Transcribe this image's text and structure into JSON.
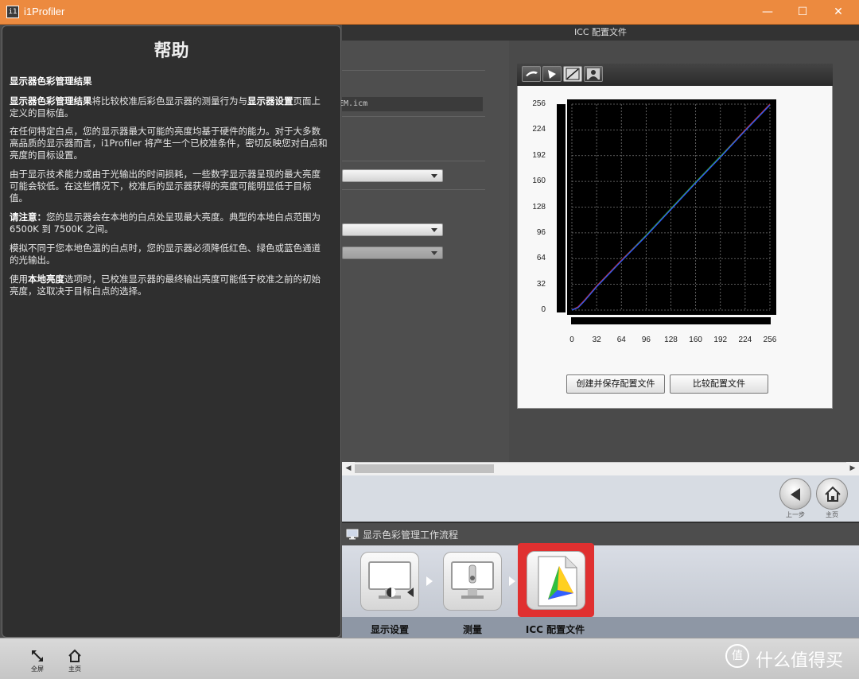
{
  "window": {
    "title": "i1Profiler",
    "app_icon": "i1",
    "minimize": "—",
    "maximize": "☐",
    "close": "✕"
  },
  "section": {
    "header": "ICC 配置文件"
  },
  "profile": {
    "filename_tail": "EM.icm"
  },
  "chart_panel": {
    "toolbar_icons": [
      "gamut-2d-icon",
      "gamut-3d-icon",
      "curve-icon",
      "image-icon"
    ],
    "create_save_button": "创建并保存配置文件",
    "compare_button": "比较配置文件"
  },
  "chart_data": {
    "type": "line",
    "title": "",
    "xlabel": "",
    "ylabel": "",
    "xlim": [
      0,
      256
    ],
    "ylim": [
      0,
      256
    ],
    "x_ticks": [
      "0",
      "32",
      "64",
      "96",
      "128",
      "160",
      "192",
      "224",
      "256"
    ],
    "y_ticks": [
      "256",
      "224",
      "192",
      "160",
      "128",
      "96",
      "64",
      "32",
      "0"
    ],
    "grid": true,
    "series": [
      {
        "color": "#e02020",
        "x": [
          0,
          8,
          16,
          32,
          64,
          96,
          128,
          160,
          192,
          224,
          256
        ],
        "y": [
          0,
          4,
          12,
          30,
          62,
          93,
          126,
          159,
          191,
          224,
          256
        ]
      },
      {
        "color": "#20c020",
        "x": [
          0,
          8,
          16,
          32,
          64,
          96,
          128,
          160,
          192,
          224,
          256
        ],
        "y": [
          0,
          3,
          11,
          29,
          61,
          93,
          126,
          159,
          191,
          223,
          255
        ]
      },
      {
        "color": "#3050ff",
        "x": [
          0,
          8,
          16,
          32,
          64,
          96,
          128,
          160,
          192,
          224,
          256
        ],
        "y": [
          0,
          3,
          11,
          29,
          61,
          92,
          125,
          158,
          190,
          223,
          255
        ]
      }
    ]
  },
  "nav": {
    "back_label": "上一步",
    "home_label": "主页"
  },
  "workflow": {
    "title": "显示色彩管理工作流程",
    "steps": [
      {
        "label": "显示设置"
      },
      {
        "label": "测量"
      },
      {
        "label": "ICC 配置文件"
      }
    ]
  },
  "help": {
    "title": "帮助",
    "heading": "显示器色彩管理结果",
    "p1_b1": "显示器色彩管理结果",
    "p1_t1": "将比较校准后彩色显示器的测量行为与",
    "p1_b2": "显示器设置",
    "p1_t2": "页面上定义的目标值。",
    "p2": "在任何特定白点，您的显示器最大可能的亮度均基于硬件的能力。对于大多数高品质的显示器而言，i1Profiler 将产生一个已校准条件，密切反映您对白点和亮度的目标设置。",
    "p3": "由于显示技术能力或由于光输出的时间损耗，一些数字显示器呈现的最大亮度可能会较低。在这些情况下，校准后的显示器获得的亮度可能明显低于目标值。",
    "p4_b": "请注意：",
    "p4_t": "您的显示器会在本地的白点处呈现最大亮度。典型的本地白点范围为 6500K 到 7500K 之间。",
    "p5": "模拟不同于您本地色温的白点时，您的显示器必须降低红色、绿色或蓝色通道的光输出。",
    "p6_t1": "使用",
    "p6_b": "本地亮度",
    "p6_t2": "选项时，已校准显示器的最终输出亮度可能低于校准之前的初始亮度，这取决于目标白点的选择。"
  },
  "bottom_bar": {
    "fullscreen_label": "全屏",
    "home_label": "主页"
  },
  "watermark": {
    "logo": "值",
    "text": "什么值得买"
  }
}
